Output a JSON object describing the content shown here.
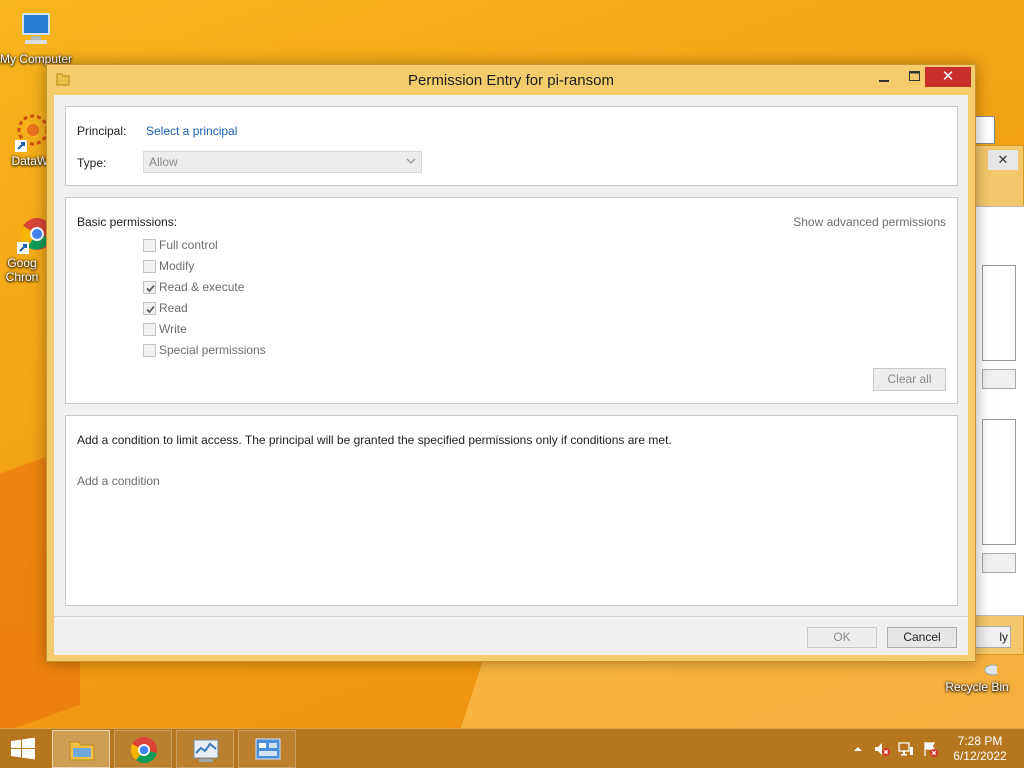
{
  "desktop": {
    "icons": [
      {
        "label": "My Computer"
      },
      {
        "label": "DataWa"
      },
      {
        "label": "Goog Chron"
      },
      {
        "label": "Recycle Bin"
      }
    ]
  },
  "behind_window": {
    "button_label": "ly"
  },
  "dialog": {
    "title": "Permission Entry for pi-ransom",
    "principal_label": "Principal:",
    "principal_link": "Select a principal",
    "type_label": "Type:",
    "type_value": "Allow",
    "basic_permissions_label": "Basic permissions:",
    "show_advanced_link": "Show advanced permissions",
    "permissions": [
      {
        "label": "Full control",
        "checked": false
      },
      {
        "label": "Modify",
        "checked": false
      },
      {
        "label": "Read & execute",
        "checked": true
      },
      {
        "label": "Read",
        "checked": true
      },
      {
        "label": "Write",
        "checked": false
      },
      {
        "label": "Special permissions",
        "checked": false
      }
    ],
    "clear_all_label": "Clear all",
    "condition_text": "Add a condition to limit access. The principal will be granted the specified permissions only if conditions are met.",
    "add_condition_link": "Add a condition",
    "ok_label": "OK",
    "cancel_label": "Cancel"
  },
  "taskbar": {
    "apps": [
      "file-explorer-icon",
      "chrome-icon",
      "task-manager-icon",
      "control-panel-icon"
    ],
    "clock_time": "7:28 PM",
    "clock_date": "6/12/2022"
  }
}
